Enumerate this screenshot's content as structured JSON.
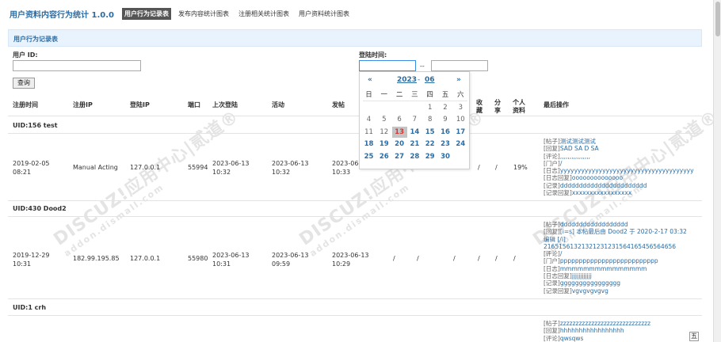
{
  "header": {
    "app_title": "用户资料内容行为统计 1.0.0",
    "tabs": [
      {
        "label": "用户行为记录表",
        "active": true
      },
      {
        "label": "发布内容统计图表",
        "active": false
      },
      {
        "label": "注册相关统计图表",
        "active": false
      },
      {
        "label": "用户资料统计图表",
        "active": false
      }
    ]
  },
  "section": {
    "title": "用户行为记录表"
  },
  "filters": {
    "user_id_label": "用户 ID:",
    "user_id_value": "",
    "login_time_label": "登陆时间:",
    "date_from_value": "",
    "date_to_value": "",
    "range_sep": "--",
    "query_button": "查询"
  },
  "table": {
    "columns": [
      "注册时间",
      "注册IP",
      "登陆IP",
      "端口",
      "上次登陆",
      "活动",
      "发帖",
      "收藏",
      "分享",
      "个人资料",
      "最后操作"
    ],
    "groups": [
      {
        "uid_label": "UID:156  test",
        "reg_time_1": "2019-02-05",
        "reg_time_2": "08:21",
        "reg_ip": "Manual Acting",
        "login_ip": "127.0.0.1",
        "port": "55994",
        "last_login_1": "2023-06-13",
        "last_login_2": "10:32",
        "activity_1": "2023-06-13",
        "activity_2": "10:32",
        "post_1": "2023-06-13",
        "post_2": "10:33",
        "fav": "/",
        "share": "/",
        "profile": "19%",
        "ops": [
          {
            "k": "[帖子]",
            "v": "测试测试测试"
          },
          {
            "k": "[回复]",
            "v": "SAD SA D SA"
          },
          {
            "k": "[评论]",
            "v": ",,,,,,,,,,,,,,,,"
          },
          {
            "k": "[门户]",
            "v": "/"
          },
          {
            "k": "[日志]",
            "v": "yyyyyyyyyyyyyyyyyyyyyyyyyyyyyyyyyyyyyy"
          },
          {
            "k": "[日志回复]",
            "v": "oooooooooooooo"
          },
          {
            "k": "[记录]",
            "v": "ddddddddddddddddddddddd"
          },
          {
            "k": "[记录回复]",
            "v": "xxxxxxxxxxxxxxxxx"
          }
        ]
      },
      {
        "uid_label": "UID:430  Dood2",
        "reg_time_1": "2019-12-29",
        "reg_time_2": "10:31",
        "reg_ip": "182.99.195.85",
        "login_ip": "127.0.0.1",
        "port": "55980",
        "last_login_1": "2023-06-13",
        "last_login_2": "10:31",
        "activity_1": "2023-06-13",
        "activity_2": "09:59",
        "post_1": "2023-06-13",
        "post_2": "10:29",
        "c7": "/",
        "c8": "/",
        "c9": "/",
        "fav": "/",
        "share": "/",
        "profile": "/",
        "ops": [
          {
            "k": "[帖子]",
            "v": "dddddddddddddddddd"
          },
          {
            "k": "[回复]",
            "v": "[i=s] 本帖最后由 Dood2 于 2020-2-17 03:32"
          },
          {
            "k": "",
            "v": "编辑 [/i]"
          },
          {
            "k": "",
            "v": "21651561321321231231564165456564656"
          },
          {
            "k": "[评论]",
            "v": "/"
          },
          {
            "k": "[门户]",
            "v": "pppppppppppppppppppppppppp"
          },
          {
            "k": "[日志]",
            "v": "mmmmmmmmmmmmmmm"
          },
          {
            "k": "[日志回复]",
            "v": "jjjjjjjjjjjj"
          },
          {
            "k": "[记录]",
            "v": "gggggggggggggggg"
          },
          {
            "k": "[记录回复]",
            "v": "vgvgvgvgvg"
          }
        ]
      },
      {
        "uid_label": "UID:1  crh",
        "ops": [
          {
            "k": "[帖子]",
            "v": "zzzzzzzzzzzzzzzzzzzzzzzzzzzzz"
          },
          {
            "k": "[回复]",
            "v": "hhhhhhhhhhhhhhhhh"
          },
          {
            "k": "[评论]",
            "v": "qwsqws"
          }
        ]
      }
    ]
  },
  "calendar": {
    "prev": "«",
    "next": "»",
    "year": "2023",
    "dash": "-",
    "month": "06",
    "weekdays": [
      "日",
      "一",
      "二",
      "三",
      "四",
      "五",
      "六"
    ],
    "days": [
      [
        "",
        "",
        "",
        "",
        "1",
        "2",
        "3"
      ],
      [
        "4",
        "5",
        "6",
        "7",
        "8",
        "9",
        "10"
      ],
      [
        "11",
        "12",
        "13",
        "14",
        "15",
        "16",
        "17"
      ],
      [
        "18",
        "19",
        "20",
        "21",
        "22",
        "23",
        "24"
      ],
      [
        "25",
        "26",
        "27",
        "28",
        "29",
        "30",
        ""
      ]
    ],
    "today": "13"
  },
  "watermark": {
    "main": "DISCUZ!应用中心|贰道®",
    "sub": "addon.dismall.com"
  },
  "ime_indicator": "五"
}
